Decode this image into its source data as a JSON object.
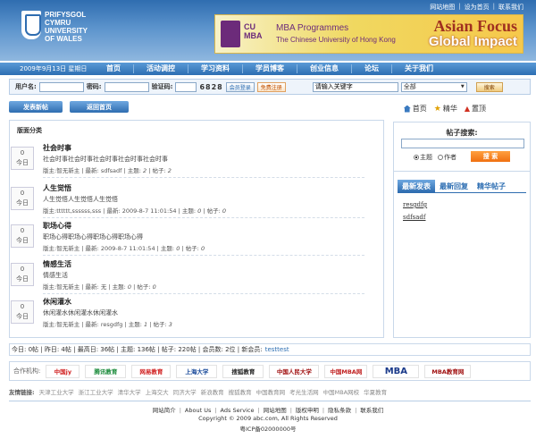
{
  "header": {
    "logo_lines": [
      "PRIFYSGOL",
      "CYMRU",
      "UNIVERSITY",
      "OF WALES"
    ],
    "top_links": [
      "网站地图",
      "设为首页",
      "联系我们"
    ],
    "banner": {
      "cu": "CU",
      "mba": "MBA",
      "line1": "MBA Programmes",
      "line2": "The Chinese University of Hong Kong",
      "headline1": "Asian Focus",
      "headline2": "Global Impact"
    }
  },
  "nav": {
    "date": "2009年9月13日 星期日",
    "items": [
      "首页",
      "活动调控",
      "学习资料",
      "学员博客",
      "创业信息",
      "论坛",
      "关于我们"
    ]
  },
  "login": {
    "username_label": "用户名:",
    "password_label": "密码:",
    "captcha_label": "验证码:",
    "captcha_value": "6828",
    "login_button": "会员登录",
    "register_button": "免费注册",
    "keyword_value": "请输入关键字",
    "scope_value": "全部",
    "search_button": "搜索"
  },
  "actions": {
    "new_post": "发表新帖",
    "back_home": "返回首页",
    "quick": [
      "首页",
      "精华",
      "置顶"
    ]
  },
  "main": {
    "section_title": "版面分类",
    "forums": [
      {
        "today_count": "0",
        "today_label": "今日",
        "name": "社会时事",
        "desc": "社会时事社会时事社会时事社会时事社会时事",
        "moderator": "智无新主",
        "latest": "sdfsadf",
        "topics": "2",
        "posts": "2"
      },
      {
        "today_count": "0",
        "today_label": "今日",
        "name": "人生觉悟",
        "desc": "人生觉悟人生觉悟人生觉悟",
        "moderator": "tttttt,ssssss,sss",
        "latest": "2009-8-7 11:01:54",
        "topics": "0",
        "posts": "0"
      },
      {
        "today_count": "0",
        "today_label": "今日",
        "name": "职场心得",
        "desc": "职场心得职场心得职场心得职场心得",
        "moderator": "智无新主",
        "latest": "2009-8-7 11:01:54",
        "topics": "0",
        "posts": "0"
      },
      {
        "today_count": "0",
        "today_label": "今日",
        "name": "情感生活",
        "desc": "情感生活",
        "moderator": "智无新主",
        "latest": "无",
        "topics": "0",
        "posts": "0"
      },
      {
        "today_count": "0",
        "today_label": "今日",
        "name": "休闲灌水",
        "desc": "休闲灌水休闲灌水休闲灌水",
        "moderator": "智无新主",
        "latest": "resgdfg",
        "topics": "1",
        "posts": "3"
      }
    ],
    "labels": {
      "moderator": "版主:",
      "latest": "最新:",
      "topics": "主题:",
      "posts": "帖子:"
    }
  },
  "side": {
    "search_title": "帖子搜索:",
    "radio_topic": "主题",
    "radio_author": "作者",
    "search_button": "搜 索",
    "tabs": [
      "最新发表",
      "最新回复",
      "精华帖子"
    ],
    "posts": [
      "resgdfg",
      "sdfsadf"
    ]
  },
  "stats": {
    "text": "今日: 0帖 | 昨日: 4帖 | 最高日: 36帖 | 主题: 136帖 | 帖子: 220帖 | 会员数: 2位 | 新会员:",
    "new_member": "testtest"
  },
  "partners": {
    "label": "合作机构:",
    "logos": [
      "中国jy",
      "腾讯教育",
      "网易教育",
      "上海大学",
      "搜狐教育",
      "中国人民大学",
      "中国MBA网",
      "MBA",
      "MBA教育网"
    ]
  },
  "friends": {
    "label": "友情链接:",
    "links": [
      "天津工业大学",
      "浙江工业大学",
      "清华大学",
      "上海交大",
      "同济大学",
      "新浪教育",
      "搜狐教育",
      "中国教育网",
      "考光生活网",
      "中国MBA网校",
      "华夏教育"
    ]
  },
  "footer": {
    "links": [
      "网站简介",
      "About Us",
      "Ads Service",
      "网站地图",
      "版权申明",
      "隐私条款",
      "联系我们"
    ],
    "copyright": "Copyright © 2009 abc.com, All Rights Reserved",
    "icp": "粤ICP备02000000号"
  },
  "colors": {
    "primary": "#2f6db0",
    "accent": "#f07010"
  }
}
